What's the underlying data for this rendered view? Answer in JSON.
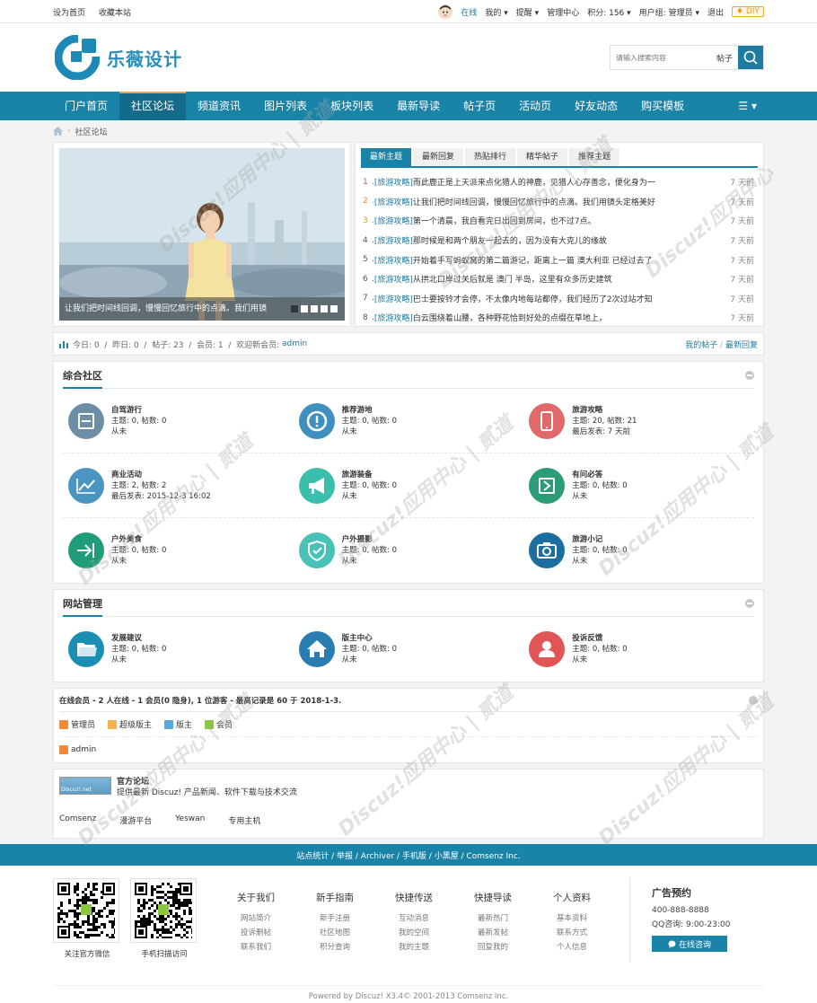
{
  "topbar": {
    "left": [
      "设为首页",
      "收藏本站"
    ],
    "online": "在线",
    "mine": "我的",
    "remind": "提醒",
    "admin_center": "管理中心",
    "credits": "积分: 156",
    "usergroup": "用户组: 管理员",
    "logout": "退出",
    "diy": "♦ DIY"
  },
  "header": {
    "logo_text": "乐薇设计",
    "search_placeholder": "请输入搜索内容",
    "search_type": "帖子"
  },
  "nav": {
    "items": [
      "门户首页",
      "社区论坛",
      "频道资讯",
      "图片列表",
      "板块列表",
      "最新导读",
      "帖子页",
      "活动页",
      "好友动态",
      "购买模板"
    ],
    "menu": "☰"
  },
  "breadcrumb": {
    "current": "社区论坛"
  },
  "slide": {
    "caption": "让我们把时间线回调，慢慢回忆旅行中的点滴。我们用镜"
  },
  "tabs": [
    "最新主题",
    "最新回复",
    "热贴排行",
    "精华帖子",
    "推荐主题"
  ],
  "threads": [
    {
      "num": "1",
      "cat": "[旅游攻略]",
      "title": "而此鹿正是上天派来点化猎人的神鹿，见猎人心存善念，便化身为一",
      "time": "7 天前",
      "color": "#d9534f"
    },
    {
      "num": "2",
      "cat": "[旅游攻略]",
      "title": "让我们把时间线回调，慢慢回忆旅行中的点滴。我们用镜头定格美好",
      "time": "7 天前",
      "color": "#e6863c"
    },
    {
      "num": "3",
      "cat": "[旅游攻略]",
      "title": "第一个清晨，我自看完日出回到房间，也不过7点。",
      "time": "7 天前",
      "color": "#c9a227"
    },
    {
      "num": "4",
      "cat": "[旅游攻略]",
      "title": "那时候是和两个朋友一起去的，因为没有大克儿的缘故",
      "time": "7 天前",
      "color": "#555555"
    },
    {
      "num": "5",
      "cat": "[旅游攻略]",
      "title": "开始着手写蚂蚁窝的第二篇游记，距离上一篇 澳大利亚 已经过去了",
      "time": "7 天前",
      "color": "#555555"
    },
    {
      "num": "6",
      "cat": "[旅游攻略]",
      "title": "从拱北口岸过关后就是 澳门 半岛，这里有众多历史建筑",
      "time": "7 天前",
      "color": "#555555"
    },
    {
      "num": "7",
      "cat": "[旅游攻略]",
      "title": "巴士要按铃才会停，不太像内地每站都停，我们经历了2次过站才知",
      "time": "7 天前",
      "color": "#555555"
    },
    {
      "num": "8",
      "cat": "[旅游攻略]",
      "title": "白云围绕着山腰，各种野花恰到好处的点缀在草地上，",
      "time": "7 天前",
      "color": "#555555"
    }
  ],
  "stats": {
    "text": "今日: 0  /  昨日: 0  /  帖子: 23  /  会员: 1  /  欢迎新会员: ",
    "newmember": "admin",
    "my_posts": "我的帖子",
    "latest_reply": "最新回复"
  },
  "group1": {
    "title": "综合社区",
    "forums": [
      {
        "name": "自驾游行",
        "l1": "主题: 0, 帖数: 0",
        "l2": "从未",
        "l3": "",
        "icon": "minus-square-icon",
        "color": "#6c8fa6"
      },
      {
        "name": "推荐游地",
        "l1": "主题: 0, 帖数: 0",
        "l2": "从未",
        "l3": "",
        "icon": "alert-icon",
        "color": "#3f8fbf"
      },
      {
        "name": "旅游攻略",
        "l1": "主题: 20, 帖数: 21",
        "l2": "最后发表: 7 天前",
        "l3": "",
        "icon": "phone-icon",
        "color": "#e06a6a"
      },
      {
        "name": "商业活动",
        "l1": "主题: 2, 帖数: 2",
        "l2": "最后发表: 2015-12-3 16:02",
        "l3": "",
        "icon": "chart-icon",
        "color": "#4b95c2"
      },
      {
        "name": "旅游装备",
        "l1": "主题: 0, 帖数: 0",
        "l2": "从未",
        "l3": "",
        "icon": "megaphone-icon",
        "color": "#3bbfad"
      },
      {
        "name": "有问必答",
        "l1": "主题: 0, 帖数: 0",
        "l2": "从未",
        "l3": "",
        "icon": "arrow-box-icon",
        "color": "#2a9c77"
      },
      {
        "name": "户外美食",
        "l1": "主题: 0, 帖数: 0",
        "l2": "从未",
        "l3": "",
        "icon": "enter-icon",
        "color": "#1f9c7a"
      },
      {
        "name": "户外摄影",
        "l1": "主题: 0, 帖数: 0",
        "l2": "从未",
        "l3": "",
        "icon": "shield-icon",
        "color": "#48c2b8"
      },
      {
        "name": "旅游小记",
        "l1": "主题: 0, 帖数: 0",
        "l2": "从未",
        "l3": "",
        "icon": "camera-icon",
        "color": "#1a6fa0"
      }
    ]
  },
  "group2": {
    "title": "网站管理",
    "forums": [
      {
        "name": "发展建议",
        "l1": "主题: 0, 帖数: 0",
        "l2": "从未",
        "icon": "folder-icon",
        "color": "#1a8fb3"
      },
      {
        "name": "版主中心",
        "l1": "主题: 0, 帖数: 0",
        "l2": "从未",
        "icon": "home-icon",
        "color": "#2a7db0"
      },
      {
        "name": "投诉反馈",
        "l1": "主题: 0, 帖数: 0",
        "l2": "从未",
        "icon": "user-icon",
        "color": "#e05555"
      }
    ]
  },
  "online": {
    "header": "在线会员 - 2 人在线 - 1 会员(0 隐身), 1 位游客 - 最高记录是 60 于 2018-1-3.",
    "legend": [
      {
        "label": "管理员",
        "color": "#f08a3a"
      },
      {
        "label": "超级版主",
        "color": "#f5b24a"
      },
      {
        "label": "版主",
        "color": "#5aa8e0"
      },
      {
        "label": "会员",
        "color": "#8cc63f"
      }
    ],
    "user": "admin"
  },
  "links": {
    "logo_text": "Discuz!.net",
    "title": "官方论坛",
    "desc": "提供最新 Discuz! 产品新闻、软件下载与技术交流",
    "items": [
      "Comsenz",
      "漫游平台",
      "Yeswan",
      "专用主机"
    ]
  },
  "footbar": "站点统计 / 举报 / Archiver / 手机版 / 小黑屋 / Comsenz Inc.",
  "footer": {
    "qr1": "关注官方微信",
    "qr2": "手机扫描访问",
    "cols": [
      {
        "h": "关于我们",
        "links": [
          "网站简介",
          "投诉删帖",
          "联系我们"
        ]
      },
      {
        "h": "新手指南",
        "links": [
          "新手注册",
          "社区地图",
          "积分查询"
        ]
      },
      {
        "h": "快捷传送",
        "links": [
          "互动消息",
          "我的空间",
          "我的主题"
        ]
      },
      {
        "h": "快捷导读",
        "links": [
          "最新热门",
          "最新发帖",
          "回复我的"
        ]
      },
      {
        "h": "个人资料",
        "links": [
          "基本资料",
          "联系方式",
          "个人信息"
        ]
      }
    ],
    "contact_title": "广告预约",
    "phone": "400-888-8888",
    "qq": "QQ咨询: 9:00-23:00",
    "contact_btn": "在线咨询"
  },
  "copyright": "Powered by Discuz! X3.4© 2001-2013 Comsenz Inc."
}
